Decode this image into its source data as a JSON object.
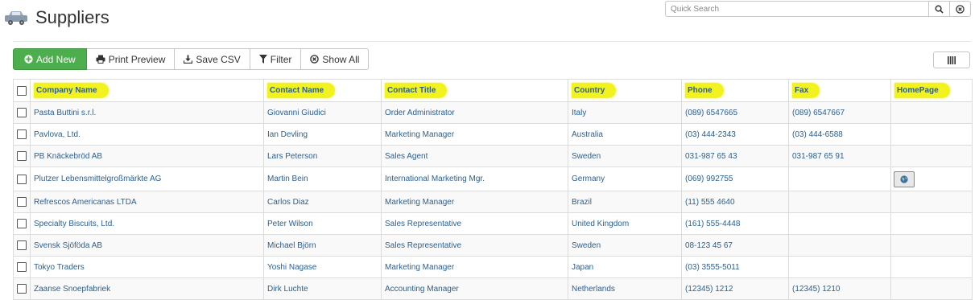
{
  "header": {
    "title": "Suppliers",
    "icon": "truck-icon"
  },
  "search": {
    "placeholder": "Quick Search",
    "value": "",
    "search_icon": "search-icon",
    "clear_icon": "clear-icon"
  },
  "toolbar": {
    "add_label": "Add New",
    "print_label": "Print Preview",
    "csv_label": "Save CSV",
    "filter_label": "Filter",
    "show_all_label": "Show All",
    "columns_icon": "columns-icon"
  },
  "colors": {
    "primary_button": "#4cae4c",
    "header_highlight": "#f2f21e",
    "link_text": "#2a5f8f"
  },
  "grid": {
    "columns": [
      "Company Name",
      "Contact Name",
      "Contact Title",
      "Country",
      "Phone",
      "Fax",
      "HomePage"
    ],
    "rows": [
      {
        "company": "Pasta Buttini s.r.l.",
        "contact": "Giovanni Giudici",
        "title": "Order Administrator",
        "country": "Italy",
        "phone": "(089) 6547665",
        "fax": "(089) 6547667",
        "homepage": false
      },
      {
        "company": "Pavlova, Ltd.",
        "contact": "Ian Devling",
        "title": "Marketing Manager",
        "country": "Australia",
        "phone": "(03) 444-2343",
        "fax": "(03) 444-6588",
        "homepage": false
      },
      {
        "company": "PB Knäckebröd AB",
        "contact": "Lars Peterson",
        "title": "Sales Agent",
        "country": "Sweden",
        "phone": "031-987 65 43",
        "fax": "031-987 65 91",
        "homepage": false
      },
      {
        "company": "Plutzer Lebensmittelgroßmärkte AG",
        "contact": "Martin Bein",
        "title": "International Marketing Mgr.",
        "country": "Germany",
        "phone": "(069) 992755",
        "fax": "",
        "homepage": true
      },
      {
        "company": "Refrescos Americanas LTDA",
        "contact": "Carlos Diaz",
        "title": "Marketing Manager",
        "country": "Brazil",
        "phone": "(11) 555 4640",
        "fax": "",
        "homepage": false
      },
      {
        "company": "Specialty Biscuits, Ltd.",
        "contact": "Peter Wilson",
        "title": "Sales Representative",
        "country": "United Kingdom",
        "phone": "(161) 555-4448",
        "fax": "",
        "homepage": false
      },
      {
        "company": "Svensk Sjöföda AB",
        "contact": "Michael Björn",
        "title": "Sales Representative",
        "country": "Sweden",
        "phone": "08-123 45 67",
        "fax": "",
        "homepage": false
      },
      {
        "company": "Tokyo Traders",
        "contact": "Yoshi Nagase",
        "title": "Marketing Manager",
        "country": "Japan",
        "phone": "(03) 3555-5011",
        "fax": "",
        "homepage": false
      },
      {
        "company": "Zaanse Snoepfabriek",
        "contact": "Dirk Luchte",
        "title": "Accounting Manager",
        "country": "Netherlands",
        "phone": "(12345) 1212",
        "fax": "(12345) 1210",
        "homepage": false
      }
    ]
  }
}
